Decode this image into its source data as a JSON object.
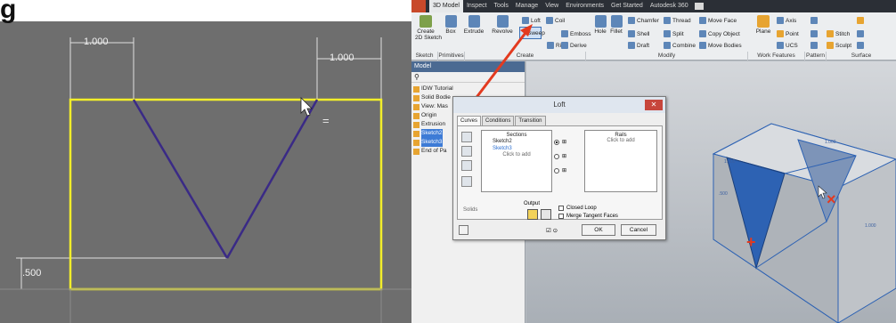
{
  "left_panel": {
    "title_fragment": "g",
    "dim_top_left": "1.000",
    "dim_top_right": "1.000",
    "dim_bottom_left": ".500"
  },
  "inventor": {
    "tabs": [
      "3D Model",
      "Inspect",
      "Tools",
      "Manage",
      "View",
      "Environments",
      "Get Started",
      "Autodesk 360"
    ],
    "active_tab": "3D Model",
    "ribbon": {
      "create_sketch": "Create\n2D Sketch",
      "box": "Box",
      "extrude": "Extrude",
      "revolve": "Revolve",
      "loft": "Loft",
      "coil": "Coil",
      "sweep": "Sweep",
      "emboss": "Emboss",
      "rib": "Rib",
      "derive": "Derive",
      "hole": "Hole",
      "fillet": "Fillet",
      "chamfer": "Chamfer",
      "thread": "Thread",
      "shell": "Shell",
      "split": "Split",
      "draft": "Draft",
      "combine": "Combine",
      "move_face": "Move Face",
      "copy_object": "Copy Object",
      "move_bodies": "Move Bodies",
      "plane": "Plane",
      "axis": "Axis",
      "point": "Point",
      "ucs": "UCS",
      "stitch": "Stitch",
      "sculpt": "Sculpt",
      "groups": {
        "sketch": "Sketch",
        "primitives": "Primitives",
        "create": "Create",
        "modify": "Modify",
        "work_features": "Work Features",
        "pattern": "Pattern",
        "surface": "Surface"
      }
    },
    "browser": {
      "header": "Model",
      "items": [
        {
          "label": "IDW Tutorial",
          "selected": false
        },
        {
          "label": "Solid Bodie",
          "selected": false
        },
        {
          "label": "View: Mas",
          "selected": false
        },
        {
          "label": "Origin",
          "selected": false
        },
        {
          "label": "Extrusion",
          "selected": false
        },
        {
          "label": "Sketch2",
          "selected": true
        },
        {
          "label": "Sketch3",
          "selected": true
        },
        {
          "label": "End of Pa",
          "selected": false
        }
      ]
    },
    "loft_dialog": {
      "title": "Loft",
      "tabs": [
        "Curves",
        "Conditions",
        "Transition"
      ],
      "sections_label": "Sections",
      "sections": [
        "Sketch2",
        "Sketch3"
      ],
      "sections_add": "Click to add",
      "rails_label": "Rails",
      "rails_add": "Click to add",
      "output_label": "Output",
      "solids_label": "Solids",
      "closed_loop": "Closed Loop",
      "merge_tangent": "Merge Tangent Faces",
      "ok": "OK",
      "cancel": "Cancel"
    },
    "viewport_labels": {
      "dim_a": "1.000",
      "dim_b": "1.000",
      "dim_c": ".500",
      "dim_d": "1.000"
    }
  },
  "colors": {
    "sketch_rect": "#f2ee2a",
    "v_line": "#3a2a86",
    "annotation_arrow": "#e33a1f",
    "face_highlight": "#2d62b3"
  }
}
